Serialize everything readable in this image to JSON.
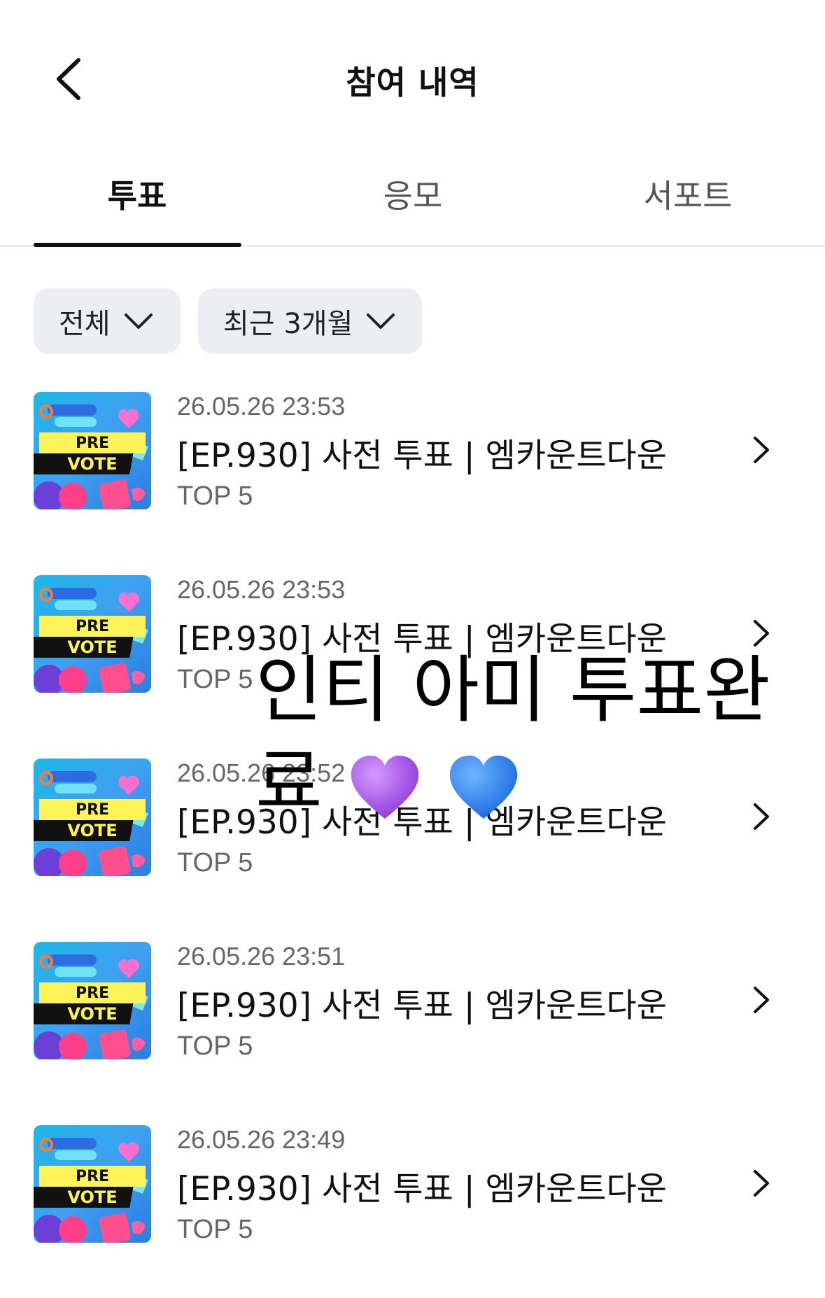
{
  "header": {
    "title": "참여 내역"
  },
  "tabs": [
    {
      "label": "투표",
      "active": true
    },
    {
      "label": "응모",
      "active": false
    },
    {
      "label": "서포트",
      "active": false
    }
  ],
  "filters": {
    "category": "전체",
    "period": "최근 3개월"
  },
  "thumbnail": {
    "line1": "PRE",
    "line2": "VOTE"
  },
  "items": [
    {
      "date": "26.05.26 23:53",
      "title": "[EP.930] 사전 투표 | 엠카운트다운",
      "sub": "TOP 5"
    },
    {
      "date": "26.05.26 23:53",
      "title": "[EP.930] 사전 투표 | 엠카운트다운",
      "sub": "TOP 5"
    },
    {
      "date": "26.05.26 23:52",
      "title": "[EP.930] 사전 투표 | 엠카운트다운",
      "sub": "TOP 5"
    },
    {
      "date": "26.05.26 23:51",
      "title": "[EP.930] 사전 투표 | 엠카운트다운",
      "sub": "TOP 5"
    },
    {
      "date": "26.05.26 23:49",
      "title": "[EP.930] 사전 투표 | 엠카운트다운",
      "sub": "TOP 5"
    }
  ],
  "overlay": {
    "text": "인티 아미 투표완료",
    "hearts": [
      "purple-heart-icon",
      "blue-heart-icon"
    ],
    "colors": {
      "purple": "#a24de6",
      "blue": "#1a73f0"
    }
  },
  "colors": {
    "filter_bg": "#eceef1",
    "text_primary": "#111111",
    "text_secondary": "#666666"
  }
}
